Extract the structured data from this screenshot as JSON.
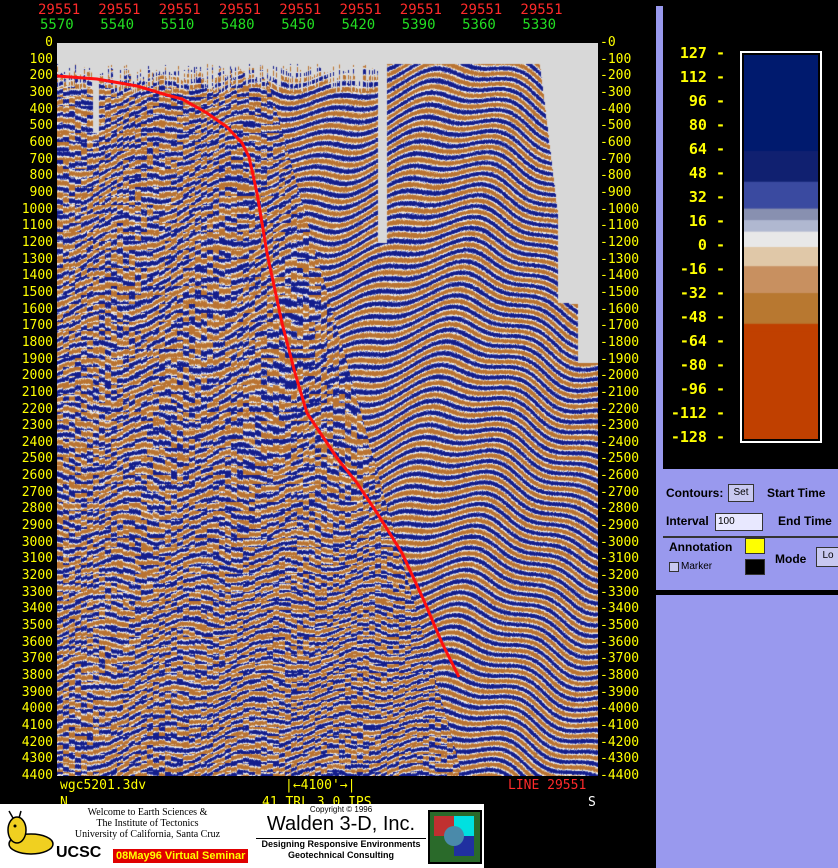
{
  "top_axis": {
    "line_labels": [
      "29551",
      "29551",
      "29551",
      "29551",
      "29551",
      "29551",
      "29551",
      "29551",
      "29551"
    ],
    "trace_labels": [
      "5570",
      "5540",
      "5510",
      "5480",
      "5450",
      "5420",
      "5390",
      "5360",
      "5330"
    ]
  },
  "depth_ticks": [
    "0",
    "100",
    "200",
    "300",
    "400",
    "500",
    "600",
    "700",
    "800",
    "900",
    "1000",
    "1100",
    "1200",
    "1300",
    "1400",
    "1500",
    "1600",
    "1700",
    "1800",
    "1900",
    "2000",
    "2100",
    "2200",
    "2300",
    "2400",
    "2500",
    "2600",
    "2700",
    "2800",
    "2900",
    "3000",
    "3100",
    "3200",
    "3300",
    "3400",
    "3500",
    "3600",
    "3700",
    "3800",
    "3900",
    "4000",
    "4100",
    "4200",
    "4300",
    "4400"
  ],
  "colorbar": {
    "labels": [
      "127",
      "112",
      "96",
      "80",
      "64",
      "48",
      "32",
      "16",
      "0",
      "-16",
      "-32",
      "-48",
      "-64",
      "-80",
      "-96",
      "-112",
      "-128"
    ],
    "colors": {
      "high": "#001a6e",
      "mid": "#e8e8e8",
      "low": "#c04000",
      "orange": "#b87830"
    }
  },
  "controls": {
    "contours_label": "Contours:",
    "set_label": "Set",
    "start_time_label": "Start Time",
    "interval_label": "Interval",
    "interval_value": "100",
    "end_time_label": "End Time",
    "annotation_label": "Annotation",
    "marker_label": "Marker",
    "mode_label": "Mode",
    "mode_button": "Lo"
  },
  "bottom": {
    "file_name": "wgc5201.3dv",
    "scale": "4100'",
    "line_name": "LINE 29551",
    "left_dir": "N",
    "right_dir": "S",
    "params": "41 TRL  3.0 IPS"
  },
  "banner": {
    "welcome_line1": "Welcome to Earth Sciences &",
    "welcome_line2": "The Institute of Tectonics",
    "welcome_line3": "University of California, Santa Cruz",
    "ucsc": "UCSC",
    "seminar": "08May96 Virtual Seminar",
    "copyright": "Copyright © 1996",
    "company": "Walden 3-D, Inc.",
    "tagline1": "Designing Responsive Environments",
    "tagline2": "Geotechnical Consulting"
  }
}
